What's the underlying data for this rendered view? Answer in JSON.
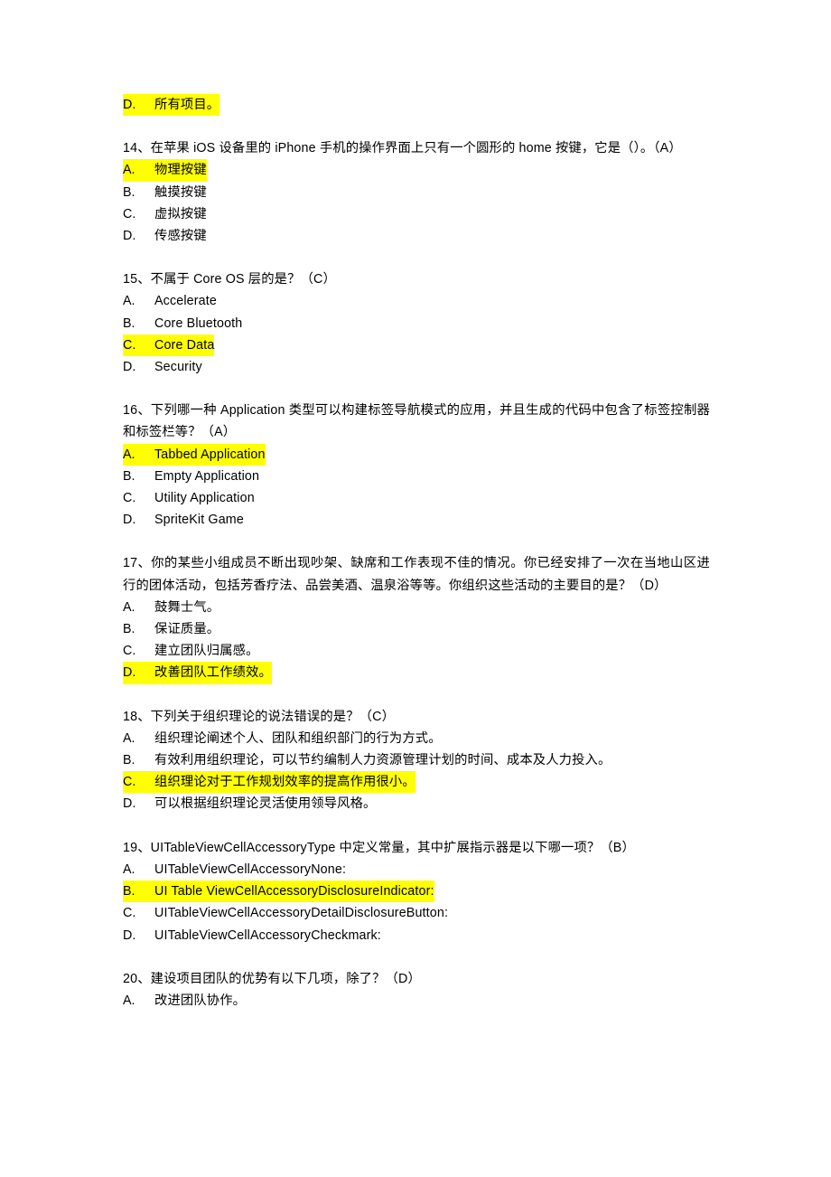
{
  "page": {
    "background_color": "#ffffff",
    "text_color": "#000000",
    "highlight_color": "#ffff00"
  },
  "leading_option": {
    "letter": "D.",
    "text": "所有项目。",
    "highlighted": true
  },
  "questions": [
    {
      "number": "14、",
      "stem": "在苹果 iOS 设备里的 iPhone 手机的操作界面上只有一个圆形的 home 按键，它是（）。（A）",
      "answer": "A",
      "options": [
        {
          "letter": "A.",
          "text": "物理按键",
          "highlighted": true
        },
        {
          "letter": "B.",
          "text": "触摸按键",
          "highlighted": false
        },
        {
          "letter": "C.",
          "text": "虚拟按键",
          "highlighted": false
        },
        {
          "letter": "D.",
          "text": "传感按键",
          "highlighted": false
        }
      ]
    },
    {
      "number": "15、",
      "stem": "不属于 Core OS 层的是？（C）",
      "answer": "C",
      "options": [
        {
          "letter": "A.",
          "text": "Accelerate",
          "highlighted": false
        },
        {
          "letter": "B.",
          "text": "Core Bluetooth",
          "highlighted": false
        },
        {
          "letter": "C.",
          "text": "Core Data",
          "highlighted": true
        },
        {
          "letter": "D.",
          "text": "Security",
          "highlighted": false
        }
      ]
    },
    {
      "number": "16、",
      "stem": "下列哪一种 Application 类型可以构建标签导航模式的应用，并且生成的代码中包含了标签控制器和标签栏等？（A）",
      "answer": "A",
      "options": [
        {
          "letter": "A.",
          "text": "Tabbed Application",
          "highlighted": true
        },
        {
          "letter": "B.",
          "text": "Empty Application",
          "highlighted": false
        },
        {
          "letter": "C.",
          "text": "Utility Application",
          "highlighted": false
        },
        {
          "letter": "D.",
          "text": "SpriteKit Game",
          "highlighted": false
        }
      ]
    },
    {
      "number": "17、",
      "stem": "你的某些小组成员不断出现吵架、缺席和工作表现不佳的情况。你已经安排了一次在当地山区进行的团体活动，包括芳香疗法、品尝美酒、温泉浴等等。你组织这些活动的主要目的是？（D）",
      "answer": "D",
      "options": [
        {
          "letter": "A.",
          "text": "鼓舞士气。",
          "highlighted": false
        },
        {
          "letter": "B.",
          "text": "保证质量。",
          "highlighted": false
        },
        {
          "letter": "C.",
          "text": "建立团队归属感。",
          "highlighted": false
        },
        {
          "letter": "D.",
          "text": "改善团队工作绩效。",
          "highlighted": true
        }
      ]
    },
    {
      "number": "18、",
      "stem": "下列关于组织理论的说法错误的是？（C）",
      "answer": "C",
      "options": [
        {
          "letter": "A.",
          "text": "组织理论阐述个人、团队和组织部门的行为方式。",
          "highlighted": false
        },
        {
          "letter": "B.",
          "text": "有效利用组织理论，可以节约编制人力资源管理计划的时间、成本及人力投入。",
          "highlighted": false
        },
        {
          "letter": "C.",
          "text": "组织理论对于工作规划效率的提高作用很小。",
          "highlighted": true
        },
        {
          "letter": "D.",
          "text": "可以根据组织理论灵活使用领导风格。",
          "highlighted": false
        }
      ]
    },
    {
      "number": "19、",
      "stem": "UITableViewCellAccessoryType 中定义常量，其中扩展指示器是以下哪一项？（B）",
      "answer": "B",
      "options": [
        {
          "letter": "A.",
          "text": "UITableViewCellAccessoryNone:",
          "highlighted": false
        },
        {
          "letter": "B.",
          "text": "UI Table ViewCellAccessoryDisclosureIndicator:",
          "highlighted": true
        },
        {
          "letter": "C.",
          "text": "UITableViewCellAccessoryDetailDisclosureButton:",
          "highlighted": false
        },
        {
          "letter": "D.",
          "text": "UITableViewCellAccessoryCheckmark:",
          "highlighted": false
        }
      ]
    },
    {
      "number": "20、",
      "stem": "建设项目团队的优势有以下几项，除了？（D）",
      "answer": "D",
      "options": [
        {
          "letter": "A.",
          "text": "改进团队协作。",
          "highlighted": false
        }
      ]
    }
  ]
}
